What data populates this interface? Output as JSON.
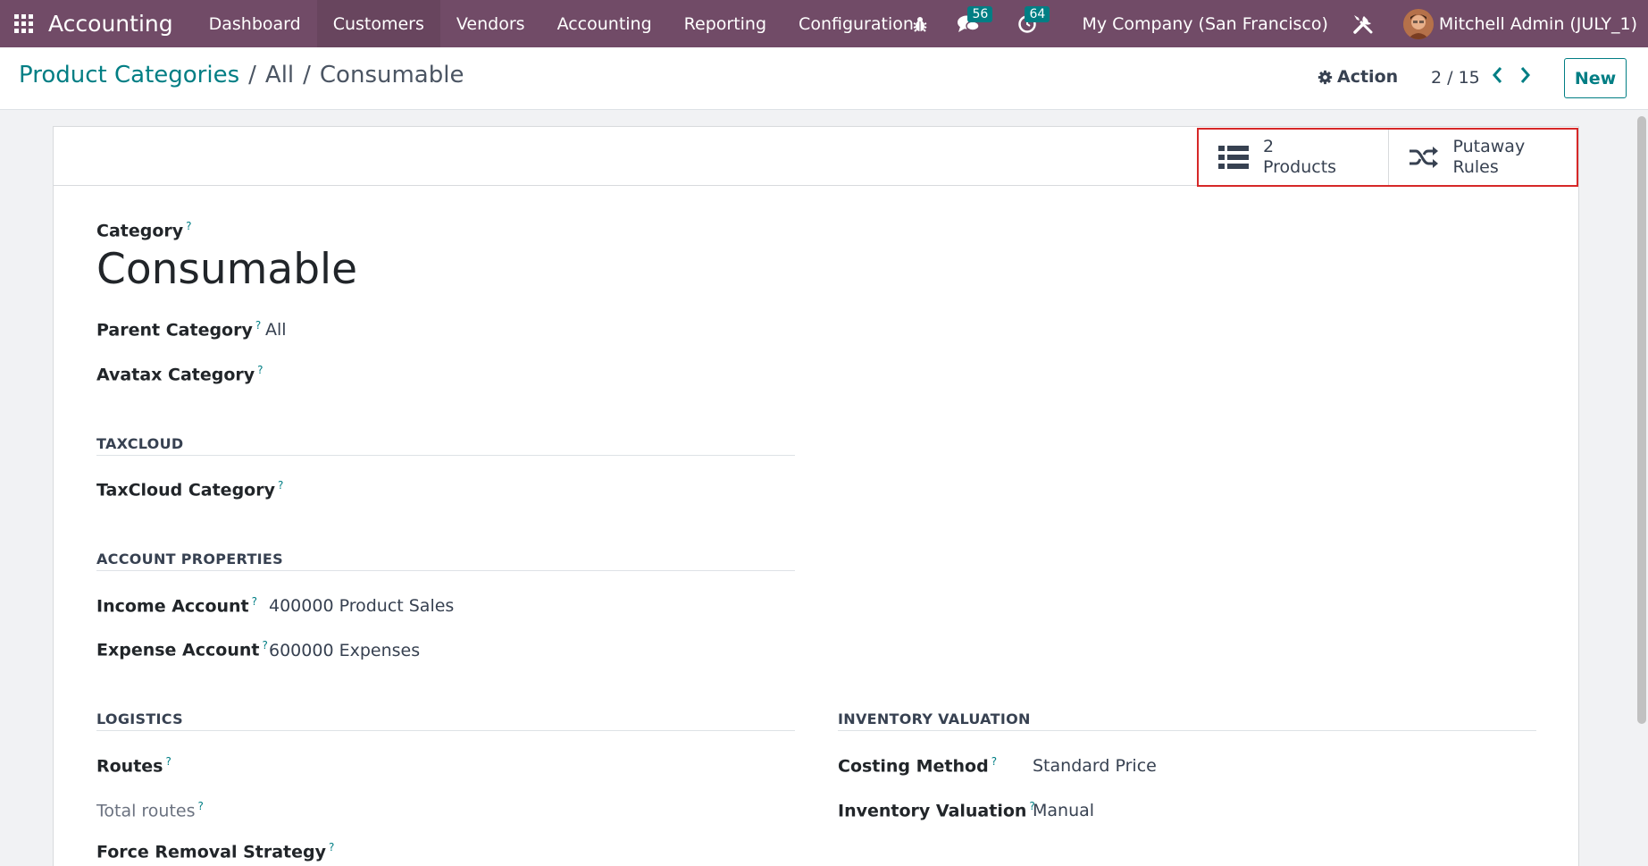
{
  "navbar": {
    "app_name": "Accounting",
    "menu": [
      "Dashboard",
      "Customers",
      "Vendors",
      "Accounting",
      "Reporting",
      "Configuration"
    ],
    "active_menu": "Customers",
    "messages_count": "56",
    "activities_count": "64",
    "company": "My Company (San Francisco)",
    "user": "Mitchell Admin (JULY_1)"
  },
  "breadcrumb": {
    "root": "Product Categories",
    "sep": "/",
    "middle": "All",
    "current": "Consumable"
  },
  "control": {
    "action_label": "Action",
    "pager": "2 / 15",
    "new_label": "New"
  },
  "stat_buttons": {
    "products_count": "2",
    "products_label": "Products",
    "putaway_line1": "Putaway",
    "putaway_line2": "Rules"
  },
  "form": {
    "category_label": "Category",
    "category_name": "Consumable",
    "parent_label": "Parent Category",
    "parent_value": "All",
    "avatax_label": "Avatax Category",
    "taxcloud_section": "TAXCLOUD",
    "taxcloud_label": "TaxCloud Category",
    "account_section": "ACCOUNT PROPERTIES",
    "income_label": "Income Account",
    "income_value": "400000 Product Sales",
    "expense_label": "Expense Account",
    "expense_value": "600000 Expenses",
    "logistics_section": "LOGISTICS",
    "routes_label": "Routes",
    "total_routes_label": "Total routes",
    "removal_label": "Force Removal Strategy",
    "valuation_section": "INVENTORY VALUATION",
    "costing_label": "Costing Method",
    "costing_value": "Standard Price",
    "inv_valuation_label": "Inventory Valuation",
    "inv_valuation_value": "Manual",
    "help_mark": "?"
  },
  "colors": {
    "navbar": "#714b67",
    "link": "#017e84",
    "highlight_border": "#d62828"
  }
}
